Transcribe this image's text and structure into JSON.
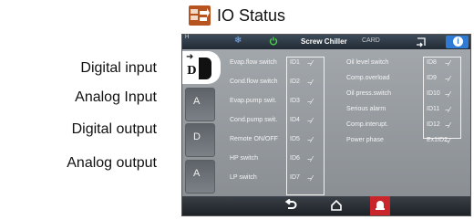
{
  "header": {
    "title": "IO Status",
    "icon": "io-status-icon",
    "icon_color": "#b6531e"
  },
  "categories": [
    "Digital input",
    "Analog Input",
    "Digital output",
    "Analog output"
  ],
  "screen": {
    "topbar": {
      "header_label": "H",
      "model": "Screw Chiller",
      "card": "CARD",
      "icons": [
        "snowflake-icon",
        "power-icon",
        "login-icon",
        "info-icon"
      ],
      "info_color": "#2e7bd6"
    },
    "tabs": [
      {
        "key": "digital-input",
        "glyph": "D",
        "active": true
      },
      {
        "key": "analog-input",
        "glyph": "A",
        "active": false
      },
      {
        "key": "digital-output",
        "glyph": "D",
        "active": false
      },
      {
        "key": "analog-output",
        "glyph": "A",
        "active": false
      }
    ],
    "left_list": [
      {
        "label": "Evap.flow switch",
        "id": "ID1"
      },
      {
        "label": "Cond.flow switch",
        "id": "ID2"
      },
      {
        "label": "Evap.pump swit.",
        "id": "ID3"
      },
      {
        "label": "Cond.pump swit.",
        "id": "ID4"
      },
      {
        "label": "Remote ON/OFF",
        "id": "ID5"
      },
      {
        "label": "HP switch",
        "id": "ID6"
      },
      {
        "label": "LP switch",
        "id": "ID7"
      }
    ],
    "right_list": [
      {
        "label": "Oil level switch",
        "id": "ID8"
      },
      {
        "label": "Comp.overload",
        "id": "ID9"
      },
      {
        "label": "Oil press.switch",
        "id": "ID10"
      },
      {
        "label": "Serious alarm",
        "id": "ID11"
      },
      {
        "label": "Comp.interupt.",
        "id": "ID12"
      },
      {
        "label": "Power phase",
        "id": "Ex1ID2"
      }
    ],
    "switch_symbol": "−⁄",
    "bottombar": {
      "buttons": [
        "back-icon",
        "home-icon",
        "alarm-icon"
      ],
      "alarm_color": "#c8262b"
    }
  }
}
